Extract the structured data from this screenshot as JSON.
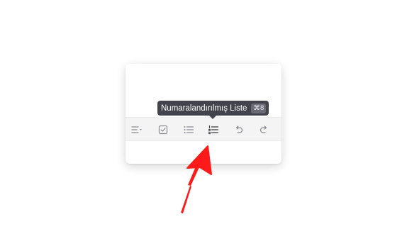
{
  "tooltip": {
    "label": "Numaralandırılmış Liste",
    "shortcut": "⌘8"
  },
  "toolbar": {
    "buttons": [
      {
        "name": "align-dropdown-button",
        "icon": "align-dropdown-icon"
      },
      {
        "name": "checklist-button",
        "icon": "checkbox-icon"
      },
      {
        "name": "bulleted-list-button",
        "icon": "bulleted-list-icon"
      },
      {
        "name": "numbered-list-button",
        "icon": "numbered-list-icon",
        "active": true
      },
      {
        "name": "undo-button",
        "icon": "undo-icon"
      },
      {
        "name": "redo-button",
        "icon": "redo-icon"
      }
    ]
  },
  "colors": {
    "icon": "#8a8a93",
    "icon_active": "#3a3a42",
    "tooltip_bg": "#43434d",
    "annotation_arrow": "#ff1a1a"
  }
}
